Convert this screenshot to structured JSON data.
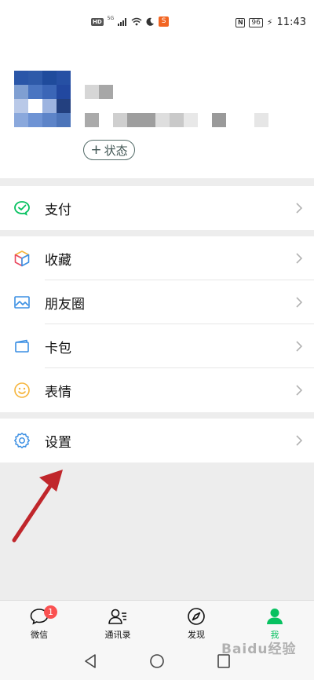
{
  "status_bar": {
    "hd_badge": "HD",
    "network": "5G",
    "battery_level": "96",
    "time": "11:43",
    "app_icon_text": "S"
  },
  "profile": {
    "status_button_plus": "+",
    "status_button_label": "状态"
  },
  "groups": [
    {
      "items": [
        {
          "label": "支付",
          "icon": "wechat-pay-icon"
        }
      ]
    },
    {
      "items": [
        {
          "label": "收藏",
          "icon": "favorites-cube-icon"
        },
        {
          "label": "朋友圈",
          "icon": "moments-image-icon"
        },
        {
          "label": "卡包",
          "icon": "card-wallet-icon"
        },
        {
          "label": "表情",
          "icon": "sticker-smile-icon"
        }
      ]
    },
    {
      "items": [
        {
          "label": "设置",
          "icon": "settings-gear-icon"
        }
      ]
    }
  ],
  "bottom_nav": {
    "tabs": [
      {
        "label": "微信",
        "icon": "chat-bubble-icon",
        "badge": "1"
      },
      {
        "label": "通讯录",
        "icon": "contacts-icon"
      },
      {
        "label": "发现",
        "icon": "compass-icon"
      },
      {
        "label": "我",
        "icon": "me-person-icon",
        "active": true
      }
    ]
  },
  "watermark": "Baidu经验",
  "colors": {
    "accent_green": "#07c160",
    "badge_red": "#fa5151",
    "annotation_arrow": "#c0262b",
    "background": "#ededed"
  }
}
